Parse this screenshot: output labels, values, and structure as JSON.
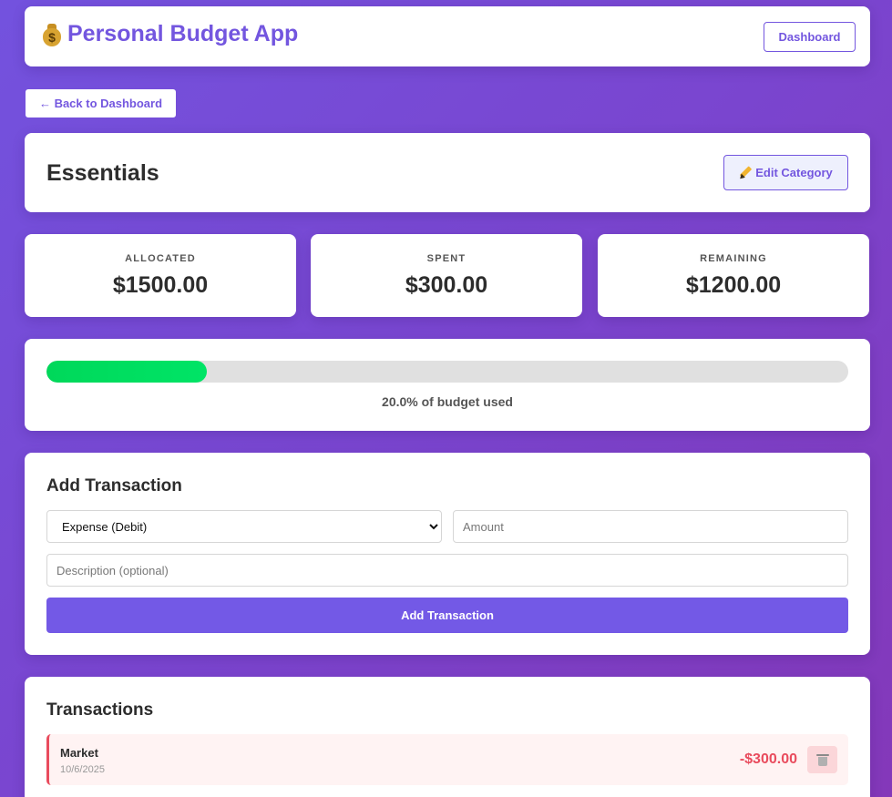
{
  "header": {
    "icon": "money-bag-icon",
    "title": "Personal Budget App",
    "dashboard_label": "Dashboard"
  },
  "back_label": "← Back to Dashboard",
  "category": {
    "name": "Essentials",
    "edit_label": "Edit Category",
    "edit_icon": "pencil-icon"
  },
  "stats": {
    "allocated": {
      "label": "ALLOCATED",
      "value": "$1500.00"
    },
    "spent": {
      "label": "SPENT",
      "value": "$300.00"
    },
    "remaining": {
      "label": "REMAINING",
      "value": "$1200.00"
    }
  },
  "progress": {
    "percent": 20.0,
    "text": "20.0% of budget used",
    "fill_color": "#00dd60"
  },
  "add_transaction": {
    "title": "Add Transaction",
    "type_selected": "Expense (Debit)",
    "amount_placeholder": "Amount",
    "description_placeholder": "Description (optional)",
    "submit_label": "Add Transaction"
  },
  "transactions": {
    "title": "Transactions",
    "items": [
      {
        "description": "Market",
        "date": "10/6/2025",
        "amount": "-$300.00",
        "type": "debit",
        "delete_icon": "trash-icon"
      }
    ]
  },
  "colors": {
    "accent": "#7356df",
    "debit": "#e94b5d",
    "progress": "#00dd60"
  }
}
